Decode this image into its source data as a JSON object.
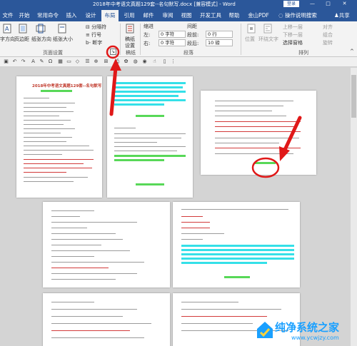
{
  "window": {
    "title": "2018年中考语文真题129套--名句默写.docx [兼容模式] - Word",
    "login_label": "登录",
    "controls": [
      "—",
      "□",
      "✕"
    ]
  },
  "tabs": [
    {
      "label": "文件"
    },
    {
      "label": "开始"
    },
    {
      "label": "常用命令"
    },
    {
      "label": "插入"
    },
    {
      "label": "设计"
    },
    {
      "label": "布局",
      "active": true
    },
    {
      "label": "引用"
    },
    {
      "label": "邮件"
    },
    {
      "label": "审阅"
    },
    {
      "label": "视图"
    },
    {
      "label": "开发工具"
    },
    {
      "label": "帮助"
    },
    {
      "label": "金山PDF"
    }
  ],
  "tell_me": "操作说明搜索",
  "share": "共享",
  "ribbon": {
    "page_setup": {
      "text_direction": "字方向",
      "margins": "页边距",
      "orientation": "纸张方向",
      "size": "纸张大小",
      "breaks": "分隔符",
      "line_numbers": "行号",
      "hyphenation": "断字",
      "group_label": "页面设置"
    },
    "draft": {
      "button_line1": "稿纸",
      "button_line2": "设置",
      "group_label": "稿纸"
    },
    "paragraph": {
      "indent_label": "缩进",
      "spacing_label": "间距",
      "left_label": "左:",
      "right_label": "右:",
      "left_value": "0 字符",
      "right_value": "0 字符",
      "before_label": "段前:",
      "after_label": "段后:",
      "before_value": "0 行",
      "after_value": "10 磅",
      "group_label": "段落"
    },
    "arrange": {
      "position": "位置",
      "wrap_text": "环绕文字",
      "bring_forward": "上移一层",
      "send_backward": "下移一层",
      "selection_pane": "选择窗格",
      "align": "对齐",
      "group": "组合",
      "rotate": "旋转",
      "group_label": "排列"
    }
  },
  "document": {
    "page1_title": "2018年中考语文真题129套--名句默写"
  },
  "watermark": {
    "brand": "纯净系统之家",
    "url": "www.ycwjzy.com"
  },
  "colors": {
    "word_blue": "#2b579a",
    "highlight_cyan": "#35e0e8",
    "highlight_green": "#58d858",
    "annotation_red": "#e01818",
    "watermark_blue": "#1aa0ff"
  }
}
